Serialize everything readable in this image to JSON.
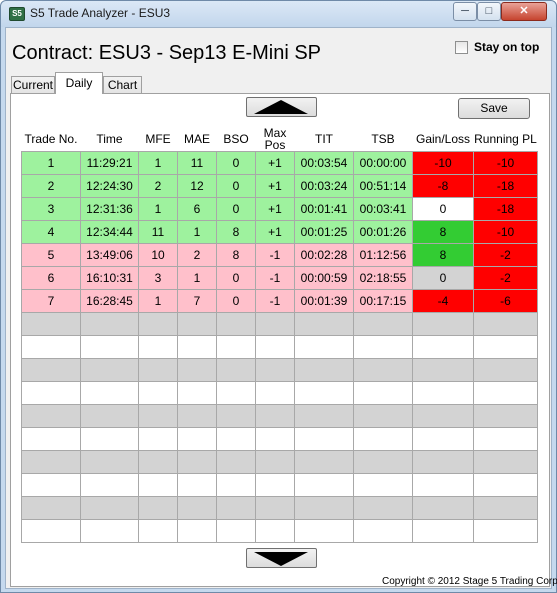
{
  "window": {
    "title": "S5 Trade Analyzer - ESU3",
    "app_icon_text": "S5",
    "min_glyph": "─",
    "max_glyph": "□",
    "close_glyph": "✕"
  },
  "header": {
    "contract_title": "Contract: ESU3 - Sep13 E-Mini SP",
    "stay_on_top_label": "Stay on top",
    "stay_on_top_checked": false
  },
  "tabs": [
    {
      "label": "Current",
      "active": false
    },
    {
      "label": "Daily",
      "active": true
    },
    {
      "label": "Chart",
      "active": false
    }
  ],
  "toolbar": {
    "save_label": "Save",
    "scroll_up_icon": "triangle-up-icon",
    "scroll_down_icon": "triangle-down-icon"
  },
  "table": {
    "headers": [
      "Trade No.",
      "Time",
      "MFE",
      "MAE",
      "BSO",
      "Max\nPos",
      "TIT",
      "TSB",
      "Gain/Loss",
      "Running PL"
    ],
    "rows": [
      {
        "cells": [
          "1",
          "11:29:21",
          "1",
          "11",
          "0",
          "+1",
          "00:03:54",
          "00:00:00",
          "-10",
          "-10"
        ],
        "row_color": "green",
        "gain_color": "red",
        "pl_color": "red"
      },
      {
        "cells": [
          "2",
          "12:24:30",
          "2",
          "12",
          "0",
          "+1",
          "00:03:24",
          "00:51:14",
          "-8",
          "-18"
        ],
        "row_color": "green",
        "gain_color": "red",
        "pl_color": "red"
      },
      {
        "cells": [
          "3",
          "12:31:36",
          "1",
          "6",
          "0",
          "+1",
          "00:01:41",
          "00:03:41",
          "0",
          "-18"
        ],
        "row_color": "green",
        "gain_color": "white",
        "pl_color": "red"
      },
      {
        "cells": [
          "4",
          "12:34:44",
          "11",
          "1",
          "8",
          "+1",
          "00:01:25",
          "00:01:26",
          "8",
          "-10"
        ],
        "row_color": "green",
        "gain_color": "bright-green",
        "pl_color": "red"
      },
      {
        "cells": [
          "5",
          "13:49:06",
          "10",
          "2",
          "8",
          "-1",
          "00:02:28",
          "01:12:56",
          "8",
          "-2"
        ],
        "row_color": "pink",
        "gain_color": "bright-green",
        "pl_color": "red"
      },
      {
        "cells": [
          "6",
          "16:10:31",
          "3",
          "1",
          "0",
          "-1",
          "00:00:59",
          "02:18:55",
          "0",
          "-2"
        ],
        "row_color": "pink",
        "gain_color": "gray",
        "pl_color": "red"
      },
      {
        "cells": [
          "7",
          "16:28:45",
          "1",
          "7",
          "0",
          "-1",
          "00:01:39",
          "00:17:15",
          "-4",
          "-6"
        ],
        "row_color": "pink",
        "gain_color": "red",
        "pl_color": "red"
      }
    ],
    "empty_rows": 10
  },
  "footer": {
    "copyright": "Copyright © 2012 Stage 5 Trading Corp."
  },
  "colors": {
    "green": "#9ef29e",
    "pink": "#ffc0cb",
    "red": "#ff0000",
    "bright-green": "#33cc33",
    "white": "#ffffff",
    "gray": "#d3d3d3",
    "empty-gray": "#d3d3d3",
    "empty-white": "#ffffff"
  }
}
